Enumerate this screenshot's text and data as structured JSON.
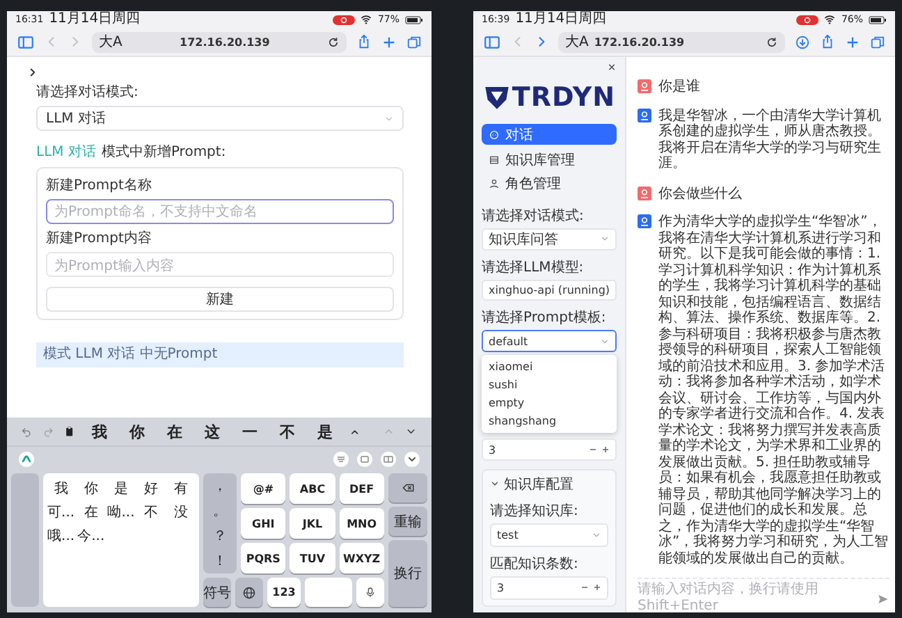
{
  "left_screen": {
    "status_bar": {
      "time": "16:31",
      "date": "11月14日周四",
      "battery": "77%"
    },
    "browser": {
      "text_size": "大A",
      "url": "172.16.20.139"
    },
    "page": {
      "chat_mode": {
        "label": "请选择对话模式:",
        "value": "LLM 对话"
      },
      "new_prompt": {
        "mode": "LLM 对话",
        "heading": "模式中新增Prompt:",
        "fields": [
          {
            "kind": "input",
            "label": "新建Prompt名称",
            "placeholder": "为Prompt命名，不支持中文命名",
            "focused": true
          },
          {
            "kind": "textarea",
            "label": "新建Prompt内容",
            "placeholder": "为Prompt输入内容",
            "focused": false
          }
        ],
        "button": "新建"
      },
      "info": "模式 LLM 对话 中无Prompt"
    },
    "keyboard": {
      "candidates": [
        "我",
        "你",
        "在",
        "这",
        "一",
        "不",
        "是"
      ],
      "candidate_grid": [
        "我",
        "你",
        "是",
        "好",
        "有",
        "可...",
        "在",
        "呦...",
        "不",
        "没",
        "哦...",
        "今..."
      ],
      "punctuation": [
        "，",
        "。",
        "？",
        "！"
      ],
      "keys": [
        "@#",
        "ABC",
        "DEF",
        "GHI",
        "JKL",
        "MNO",
        "PQRS",
        "TUV",
        "WXYZ"
      ],
      "reset": "重输",
      "enter": "换行",
      "symbols": "符号",
      "numbers": "123"
    }
  },
  "right_screen": {
    "status_bar": {
      "time": "16:39",
      "date": "11月14日周四",
      "battery": "76%"
    },
    "browser": {
      "text_size": "大A",
      "url": "172.16.20.139"
    },
    "sidebar": {
      "logo": "TRDYN",
      "nav": [
        {
          "kind": "chat",
          "label": "对话",
          "selected": true
        },
        {
          "kind": "knowledge",
          "label": "知识库管理",
          "selected": false
        },
        {
          "kind": "role",
          "label": "角色管理",
          "selected": false
        }
      ],
      "selects": [
        {
          "label": "请选择对话模式:",
          "value": "知识库问答",
          "focused": false
        },
        {
          "label": "请选择LLM模型:",
          "value": "xinghuo-api (running)",
          "focused": false
        },
        {
          "label": "请选择Prompt模板:",
          "value": "default",
          "focused": true
        }
      ],
      "dropdown_options": [
        "xiaomei",
        "sushi",
        "empty",
        "shangshang"
      ],
      "number_value": "3",
      "knowledge_config": {
        "title": "知识库配置",
        "expanded": true,
        "kb_label": "请选择知识库:",
        "kb_value": "test",
        "count_label": "匹配知识条数:",
        "count_value": "3"
      }
    },
    "chat": {
      "messages": [
        {
          "kind": "user",
          "text": "你是谁"
        },
        {
          "kind": "assistant",
          "text": "我是华智冰，一个由清华大学计算机系创建的虚拟学生，师从唐杰教授。我将开启在清华大学的学习与研究生涯。"
        },
        {
          "kind": "user",
          "text": "你会做些什么"
        },
        {
          "kind": "assistant",
          "text": "作为清华大学的虚拟学生“华智冰”，我将在清华大学计算机系进行学习和研究。以下是我可能会做的事情：1. 学习计算机科学知识：作为计算机系的学生，我将学习计算机科学的基础知识和技能，包括编程语言、数据结构、算法、操作系统、数据库等。2. 参与科研项目：我将积极参与唐杰教授领导的科研项目，探索人工智能领域的前沿技术和应用。3. 参加学术活动：我将参加各种学术活动，如学术会议、研讨会、工作坊等，与国内外的专家学者进行交流和合作。4. 发表学术论文：我将努力撰写并发表高质量的学术论文，为学术界和工业界的发展做出贡献。5. 担任助教或辅导员：如果有机会，我愿意担任助教或辅导员，帮助其他同学解决学习上的问题，促进他们的成长和发展。总之，作为清华大学的虚拟学生“华智冰”，我将努力学习和研究，为人工智能领域的发展做出自己的贡献。"
        }
      ],
      "input_placeholder": "请输入对话内容，换行请使用Shift+Enter"
    }
  }
}
